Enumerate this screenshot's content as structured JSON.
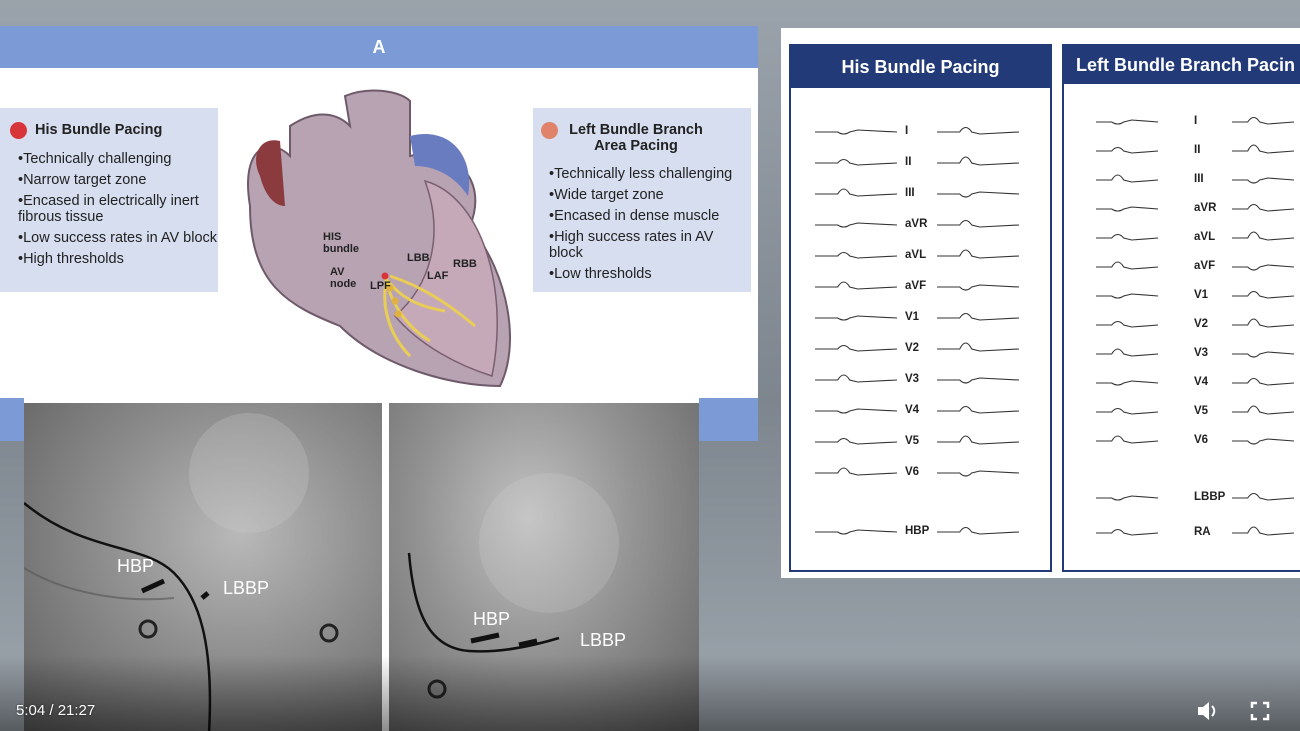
{
  "slide_a": {
    "header": "A",
    "his_box": {
      "title": "His Bundle Pacing",
      "dot_color": "#d8353a",
      "bullets": [
        "Technically challenging",
        "Narrow target zone",
        "Encased in electrically inert fibrous tissue",
        "Low success rates in AV block",
        "High thresholds"
      ]
    },
    "lbb_box": {
      "title": "Left Bundle Branch Area Pacing",
      "dot_color": "#e0836a",
      "bullets": [
        "Technically less challenging",
        "Wide target zone",
        "Encased in dense muscle",
        "High success rates in AV block",
        "Low thresholds"
      ]
    },
    "heart_labels": {
      "his": "HIS bundle",
      "lbb": "LBB",
      "rbb": "RBB",
      "laf": "LAF",
      "av": "AV node",
      "lpf": "LPF"
    }
  },
  "fluoro": {
    "rao": {
      "hbp": "HBP",
      "lbbp": "LBBP"
    },
    "lao": {
      "hbp": "HBP",
      "lbbp": "LBBP"
    }
  },
  "ecg_panel": {
    "his_title": "His Bundle Pacing",
    "lbb_title": "Left Bundle Branch Pacin",
    "his_leads": [
      "I",
      "II",
      "III",
      "aVR",
      "aVL",
      "aVF",
      "V1",
      "V2",
      "V3",
      "V4",
      "V5",
      "V6",
      "HBP"
    ],
    "lbb_leads": [
      "I",
      "II",
      "III",
      "aVR",
      "aVL",
      "aVF",
      "V1",
      "V2",
      "V3",
      "V4",
      "V5",
      "V6",
      "LBBP",
      "RA"
    ]
  },
  "player": {
    "time": "5:04 / 21:27",
    "icons": {
      "volume": "volume-icon",
      "fullscreen": "fullscreen-icon"
    }
  }
}
